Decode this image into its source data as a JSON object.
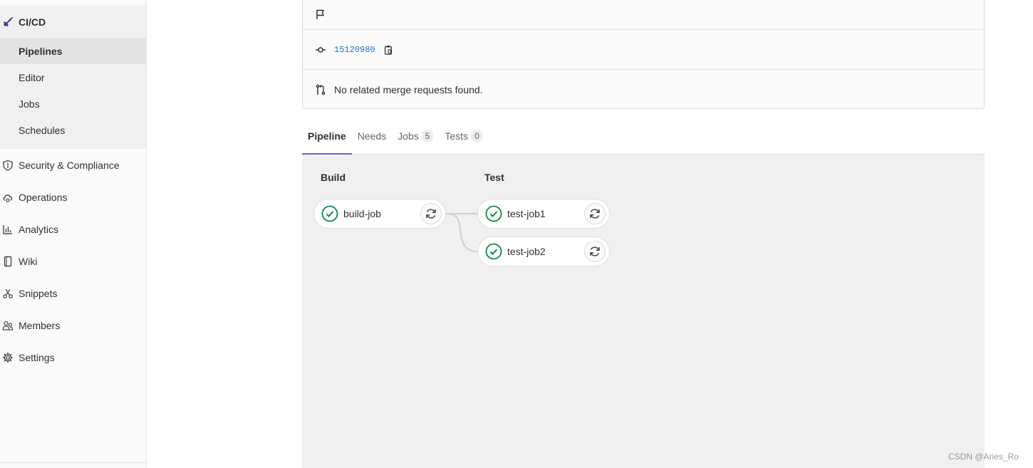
{
  "sidebar": {
    "section": {
      "label": "CI/CD",
      "icon": "rocket-icon"
    },
    "subitems": [
      {
        "label": "Pipelines",
        "active": true
      },
      {
        "label": "Editor",
        "active": false
      },
      {
        "label": "Jobs",
        "active": false
      },
      {
        "label": "Schedules",
        "active": false
      }
    ],
    "items": [
      {
        "label": "Security & Compliance",
        "icon": "shield-icon"
      },
      {
        "label": "Operations",
        "icon": "cloud-gear-icon"
      },
      {
        "label": "Analytics",
        "icon": "chart-icon"
      },
      {
        "label": "Wiki",
        "icon": "book-icon"
      },
      {
        "label": "Snippets",
        "icon": "scissors-icon"
      },
      {
        "label": "Members",
        "icon": "users-icon"
      },
      {
        "label": "Settings",
        "icon": "gear-icon"
      }
    ]
  },
  "info": {
    "commit_sha": "15120980",
    "merge_requests_text": "No related merge requests found."
  },
  "tabs": [
    {
      "label": "Pipeline",
      "active": true,
      "count": null
    },
    {
      "label": "Needs",
      "active": false,
      "count": null
    },
    {
      "label": "Jobs",
      "active": false,
      "count": "5"
    },
    {
      "label": "Tests",
      "active": false,
      "count": "0"
    }
  ],
  "pipeline": {
    "stages": [
      {
        "title": "Build",
        "jobs": [
          {
            "name": "build-job",
            "status": "passed"
          }
        ]
      },
      {
        "title": "Test",
        "jobs": [
          {
            "name": "test-job1",
            "status": "passed"
          },
          {
            "name": "test-job2",
            "status": "passed"
          }
        ]
      }
    ]
  },
  "colors": {
    "success": "#108548",
    "accent": "#6666c4",
    "link": "#1f75cb"
  },
  "watermark": "CSDN @Aries_Ro"
}
